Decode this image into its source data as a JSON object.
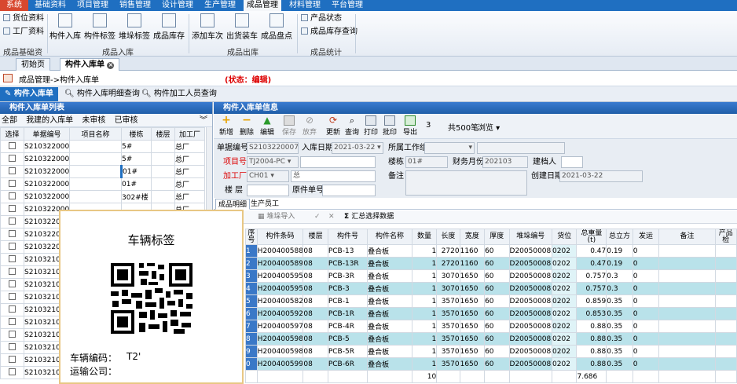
{
  "menu": {
    "items": [
      "系统",
      "基础资料",
      "项目管理",
      "销售管理",
      "设计管理",
      "生产管理",
      "成品管理",
      "材料管理",
      "平台管理"
    ],
    "active": "成品管理"
  },
  "ribbon": {
    "small_left": [
      "货位资料",
      "工厂资料"
    ],
    "group_basic": "成品基础资料",
    "warehouse_buttons": [
      "构件入库",
      "构件标签",
      "堆垛标签",
      "成品库存"
    ],
    "group_warehouse": "成品入库",
    "outbound_buttons": [
      "添加车次",
      "出货装车",
      "成品盘点"
    ],
    "group_outbound": "成品出库",
    "small_stats": [
      "产品状态",
      "成品库存查询"
    ],
    "group_stats": "成品统计"
  },
  "doc_tabs": [
    "初始页",
    "构件入库单"
  ],
  "breadcrumb": {
    "path": "成品管理->构件入库单",
    "status": "(状态：编辑)"
  },
  "page_tabs": [
    "构件入库单",
    "构件入库明细查询",
    "构件加工人员查询"
  ],
  "left_panel": {
    "title": "构件入库单列表",
    "filters": [
      "全部",
      "我建的入库单",
      "未审核",
      "已审核"
    ],
    "columns": [
      "选择",
      "单据编号",
      "项目名称",
      "楼栋",
      "楼层",
      "加工厂"
    ],
    "rows": [
      {
        "no": "S2103220009",
        "project": "",
        "building": "5#",
        "floor": "",
        "factory": "总厂"
      },
      {
        "no": "S2103220008",
        "project": "",
        "building": "5#",
        "floor": "",
        "factory": "总厂"
      },
      {
        "no": "S2103220007",
        "project": "",
        "building": "01#",
        "floor": "",
        "factory": "总厂"
      },
      {
        "no": "S2103220006",
        "project": "",
        "building": "01#",
        "floor": "",
        "factory": "总厂"
      },
      {
        "no": "S2103220005",
        "project": "",
        "building": "302#楼",
        "floor": "",
        "factory": "总厂"
      },
      {
        "no": "S210322000",
        "project": "",
        "building": "",
        "floor": "",
        "factory": "总厂"
      },
      {
        "no": "S210322000",
        "project": "",
        "building": "",
        "floor": "",
        "factory": ""
      },
      {
        "no": "S210322000",
        "project": "",
        "building": "",
        "floor": "",
        "factory": ""
      },
      {
        "no": "S210322000",
        "project": "",
        "building": "",
        "floor": "",
        "factory": ""
      },
      {
        "no": "S21032100",
        "project": "",
        "building": "",
        "floor": "",
        "factory": ""
      },
      {
        "no": "S21032100",
        "project": "",
        "building": "",
        "floor": "",
        "factory": ""
      },
      {
        "no": "S21032100",
        "project": "",
        "building": "",
        "floor": "",
        "factory": ""
      },
      {
        "no": "S21032100",
        "project": "",
        "building": "",
        "floor": "",
        "factory": ""
      },
      {
        "no": "S21032100",
        "project": "",
        "building": "",
        "floor": "",
        "factory": ""
      },
      {
        "no": "S21032100",
        "project": "",
        "building": "",
        "floor": "",
        "factory": ""
      },
      {
        "no": "S21032100",
        "project": "",
        "building": "",
        "floor": "",
        "factory": ""
      },
      {
        "no": "S21032100",
        "project": "",
        "building": "",
        "floor": "",
        "factory": ""
      },
      {
        "no": "S21032100",
        "project": "",
        "building": "",
        "floor": "",
        "factory": ""
      },
      {
        "no": "S21032100",
        "project": "",
        "building": "",
        "floor": "",
        "factory": ""
      }
    ]
  },
  "right_panel": {
    "title": "构件入库单信息",
    "toolbar": [
      "新增",
      "删除",
      "编辑",
      "保存",
      "放弃",
      "更新",
      "查询",
      "打印",
      "批印",
      "导出"
    ],
    "page_num": "3",
    "total": "共500笔",
    "browse": "浏览",
    "form": {
      "doc_no_label": "单据编号",
      "doc_no": "S2103220007",
      "in_date_label": "入库日期",
      "in_date": "2021-03-22",
      "workgroup_label": "所属工作组",
      "project_label": "项目号",
      "project": "TJ2004-PC",
      "building_label": "楼栋",
      "building": "01#",
      "finance_label": "财务月份",
      "finance": "202103",
      "creator_label": "建档人",
      "factory_label": "加工厂",
      "factory": "CH01",
      "factory_name": "总",
      "remark_label": "备注",
      "create_date_label": "创建日期",
      "create_date": "2021-03-22",
      "floor_label": "楼 层",
      "orig_no_label": "原件单号"
    },
    "sub_tabs": [
      "成品明细",
      "生产员工"
    ],
    "sub_tools": [
      "堆垛导入",
      "汇总选择数据"
    ],
    "columns": [
      "序号",
      "构件条码",
      "楼层",
      "构件号",
      "构件名称",
      "数量",
      "长度",
      "宽度",
      "厚度",
      "堆垛编号",
      "货位",
      "总重量(t)",
      "总立方",
      "发运",
      "备注",
      "产品检"
    ],
    "rows": [
      {
        "idx": "1",
        "code": "H20040058878",
        "floor": "08",
        "part": "PCB-13",
        "name": "叠合板",
        "qty": "1",
        "len": "2720",
        "wid": "1160",
        "thk": "60",
        "stack": "D2005000820",
        "loc": "0202",
        "wt": "0.47",
        "vol": "0.19",
        "ship": "0"
      },
      {
        "idx": "2",
        "code": "H20040058968",
        "floor": "08",
        "part": "PCB-13R",
        "name": "叠合板",
        "qty": "1",
        "len": "2720",
        "wid": "1160",
        "thk": "60",
        "stack": "D2005000820",
        "loc": "0202",
        "wt": "0.47",
        "vol": "0.19",
        "ship": "0"
      },
      {
        "idx": "3",
        "code": "H20040059598",
        "floor": "08",
        "part": "PCB-3R",
        "name": "叠合板",
        "qty": "1",
        "len": "3070",
        "wid": "1650",
        "thk": "60",
        "stack": "D2005000820",
        "loc": "0202",
        "wt": "0.757",
        "vol": "0.3",
        "ship": "0"
      },
      {
        "idx": "4",
        "code": "H20040059508",
        "floor": "08",
        "part": "PCB-3",
        "name": "叠合板",
        "qty": "1",
        "len": "3070",
        "wid": "1650",
        "thk": "60",
        "stack": "D2005000820",
        "loc": "0202",
        "wt": "0.757",
        "vol": "0.3",
        "ship": "0"
      },
      {
        "idx": "5",
        "code": "H20040058248",
        "floor": "08",
        "part": "PCB-1",
        "name": "叠合板",
        "qty": "1",
        "len": "3570",
        "wid": "1650",
        "thk": "60",
        "stack": "D2005000820",
        "loc": "0202",
        "wt": "0.859",
        "vol": "0.35",
        "ship": "0"
      },
      {
        "idx": "6",
        "code": "H20040059238",
        "floor": "08",
        "part": "PCB-1R",
        "name": "叠合板",
        "qty": "1",
        "len": "3570",
        "wid": "1650",
        "thk": "60",
        "stack": "D2005000820",
        "loc": "0202",
        "wt": "0.853",
        "vol": "0.35",
        "ship": "0"
      },
      {
        "idx": "7",
        "code": "H20040059778",
        "floor": "08",
        "part": "PCB-4R",
        "name": "叠合板",
        "qty": "1",
        "len": "3570",
        "wid": "1650",
        "thk": "60",
        "stack": "D2005000820",
        "loc": "0202",
        "wt": "0.88",
        "vol": "0.35",
        "ship": "0"
      },
      {
        "idx": "8",
        "code": "H20040059868",
        "floor": "08",
        "part": "PCB-5",
        "name": "叠合板",
        "qty": "1",
        "len": "3570",
        "wid": "1650",
        "thk": "60",
        "stack": "D2005000820",
        "loc": "0202",
        "wt": "0.88",
        "vol": "0.35",
        "ship": "0"
      },
      {
        "idx": "9",
        "code": "H20040059868",
        "floor": "08",
        "part": "PCB-5R",
        "name": "叠合板",
        "qty": "1",
        "len": "3570",
        "wid": "1650",
        "thk": "60",
        "stack": "D2005000820",
        "loc": "0202",
        "wt": "0.88",
        "vol": "0.35",
        "ship": "0"
      },
      {
        "idx": "0",
        "code": "H20040059958",
        "floor": "08",
        "part": "PCB-6R",
        "name": "叠合板",
        "qty": "1",
        "len": "3570",
        "wid": "1650",
        "thk": "60",
        "stack": "D2005000820",
        "loc": "0202",
        "wt": "0.88",
        "vol": "0.35",
        "ship": "0"
      }
    ],
    "totals": {
      "qty": "10",
      "wt": "7.686"
    }
  },
  "popup": {
    "title": "车辆标签",
    "vehicle_label": "车辆编码：",
    "vehicle_value": "T2'",
    "company_label": "运输公司："
  },
  "colors": {
    "menu_bar": "#1f6fc1",
    "system_tab": "#d8482f",
    "selected_row": "#b9e2ea",
    "required_label": "#dd0000"
  }
}
